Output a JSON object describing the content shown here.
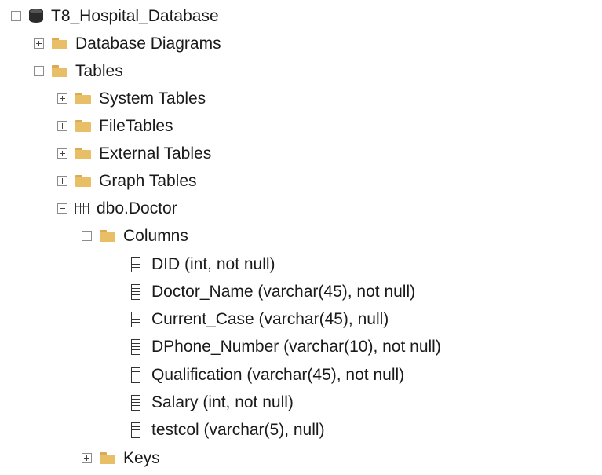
{
  "tree": {
    "database": {
      "label": "T8_Hospital_Database",
      "icon": "database-icon",
      "expanded": true
    },
    "database_diagrams": {
      "label": "Database Diagrams",
      "icon": "folder-icon",
      "expanded": false
    },
    "tables": {
      "label": "Tables",
      "icon": "folder-icon",
      "expanded": true
    },
    "system_tables": {
      "label": "System Tables",
      "icon": "folder-icon",
      "expanded": false
    },
    "file_tables": {
      "label": "FileTables",
      "icon": "folder-icon",
      "expanded": false
    },
    "external_tables": {
      "label": "External Tables",
      "icon": "folder-icon",
      "expanded": false
    },
    "graph_tables": {
      "label": "Graph Tables",
      "icon": "folder-icon",
      "expanded": false
    },
    "doctor_table": {
      "label": "dbo.Doctor",
      "icon": "table-icon",
      "expanded": true
    },
    "columns_folder": {
      "label": "Columns",
      "icon": "folder-icon",
      "expanded": true
    },
    "columns": [
      {
        "label": "DID (int, not null)",
        "icon": "column-icon"
      },
      {
        "label": "Doctor_Name (varchar(45), not null)",
        "icon": "column-icon"
      },
      {
        "label": "Current_Case (varchar(45), null)",
        "icon": "column-icon"
      },
      {
        "label": "DPhone_Number (varchar(10), not null)",
        "icon": "column-icon"
      },
      {
        "label": "Qualification (varchar(45), not null)",
        "icon": "column-icon"
      },
      {
        "label": "Salary (int, not null)",
        "icon": "column-icon"
      },
      {
        "label": "testcol (varchar(5), null)",
        "icon": "column-icon"
      }
    ],
    "keys_folder": {
      "label": "Keys",
      "icon": "folder-icon",
      "expanded": false
    }
  },
  "colors": {
    "folder": "#e8bf66",
    "text": "#1a1a1a",
    "background": "#ffffff"
  }
}
